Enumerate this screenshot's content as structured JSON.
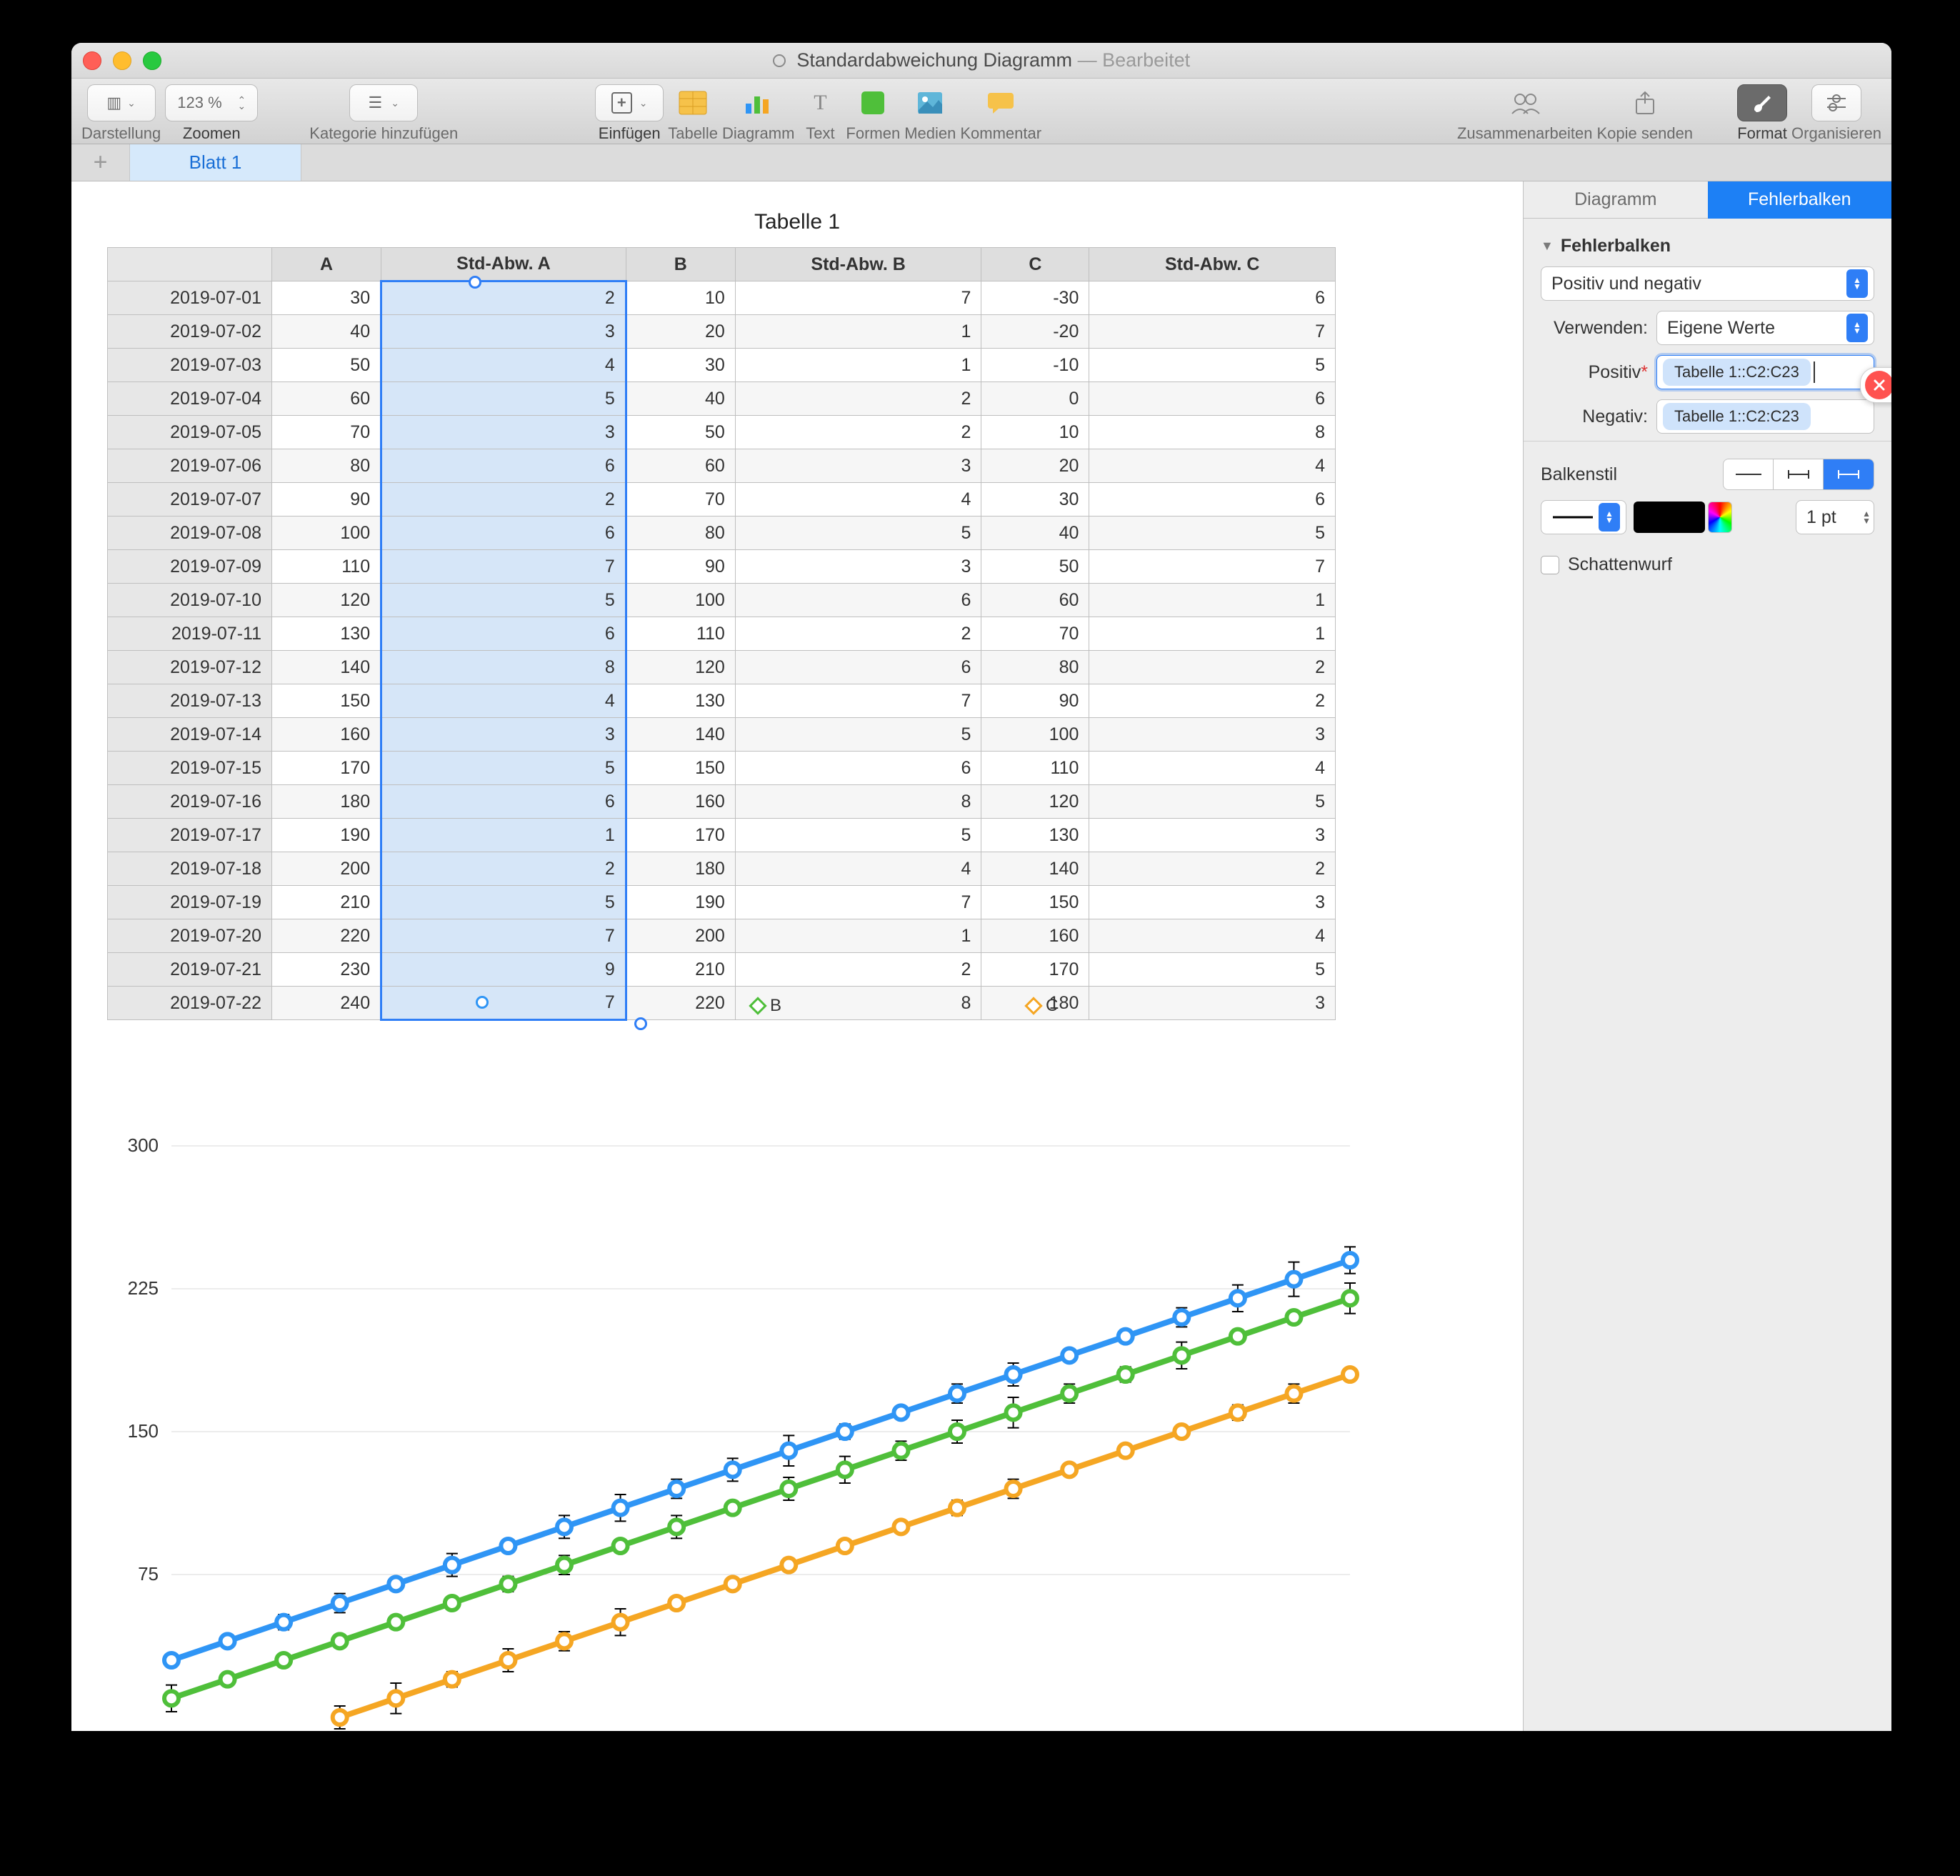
{
  "window": {
    "doc_title": "Standardabweichung Diagramm",
    "status": "Bearbeitet",
    "sep": " — "
  },
  "toolbar": {
    "view_label": "Darstellung",
    "zoom_value": "123 %",
    "zoom_label": "Zoomen",
    "category_label": "Kategorie hinzufügen",
    "insert_label": "Einfügen",
    "table_label": "Tabelle",
    "chart_label": "Diagramm",
    "text_label": "Text",
    "shapes_label": "Formen",
    "media_label": "Medien",
    "comment_label": "Kommentar",
    "collab_label": "Zusammenarbeiten",
    "share_label": "Kopie senden",
    "format_label": "Format",
    "organize_label": "Organisieren"
  },
  "sheets": {
    "add": "+",
    "tab1": "Blatt 1"
  },
  "inspector": {
    "tab_chart": "Diagramm",
    "tab_error": "Fehlerbalken",
    "section": "Fehlerbalken",
    "mode": "Positiv und negativ",
    "use_label": "Verwenden:",
    "use_value": "Eigene Werte",
    "pos_label": "Positiv",
    "neg_label": "Negativ:",
    "range_token": "Tabelle 1::C2:C23",
    "barstyle_label": "Balkenstil",
    "width_value": "1 pt",
    "shadow_label": "Schattenwurf"
  },
  "table": {
    "title": "Tabelle 1",
    "columns": [
      "",
      "A",
      "Std-Abw. A",
      "B",
      "Std-Abw. B",
      "C",
      "Std-Abw. C"
    ],
    "rows": [
      [
        "2019-07-01",
        30,
        2,
        10,
        7,
        -30,
        6
      ],
      [
        "2019-07-02",
        40,
        3,
        20,
        1,
        -20,
        7
      ],
      [
        "2019-07-03",
        50,
        4,
        30,
        1,
        -10,
        5
      ],
      [
        "2019-07-04",
        60,
        5,
        40,
        2,
        0,
        6
      ],
      [
        "2019-07-05",
        70,
        3,
        50,
        2,
        10,
        8
      ],
      [
        "2019-07-06",
        80,
        6,
        60,
        3,
        20,
        4
      ],
      [
        "2019-07-07",
        90,
        2,
        70,
        4,
        30,
        6
      ],
      [
        "2019-07-08",
        100,
        6,
        80,
        5,
        40,
        5
      ],
      [
        "2019-07-09",
        110,
        7,
        90,
        3,
        50,
        7
      ],
      [
        "2019-07-10",
        120,
        5,
        100,
        6,
        60,
        1
      ],
      [
        "2019-07-11",
        130,
        6,
        110,
        2,
        70,
        1
      ],
      [
        "2019-07-12",
        140,
        8,
        120,
        6,
        80,
        2
      ],
      [
        "2019-07-13",
        150,
        4,
        130,
        7,
        90,
        2
      ],
      [
        "2019-07-14",
        160,
        3,
        140,
        5,
        100,
        3
      ],
      [
        "2019-07-15",
        170,
        5,
        150,
        6,
        110,
        4
      ],
      [
        "2019-07-16",
        180,
        6,
        160,
        8,
        120,
        5
      ],
      [
        "2019-07-17",
        190,
        1,
        170,
        5,
        130,
        3
      ],
      [
        "2019-07-18",
        200,
        2,
        180,
        4,
        140,
        2
      ],
      [
        "2019-07-19",
        210,
        5,
        190,
        7,
        150,
        3
      ],
      [
        "2019-07-20",
        220,
        7,
        200,
        1,
        160,
        4
      ],
      [
        "2019-07-21",
        230,
        9,
        210,
        2,
        170,
        5
      ],
      [
        "2019-07-22",
        240,
        7,
        220,
        8,
        180,
        3
      ]
    ],
    "legend_b": "B",
    "legend_c": "C"
  },
  "chart_data": {
    "type": "line",
    "title": "",
    "xlabel": "",
    "ylabel": "",
    "ylim": [
      0,
      300
    ],
    "yticks": [
      75,
      150,
      225,
      300
    ],
    "categories": [
      "2019-07-01",
      "2019-07-02",
      "2019-07-03",
      "2019-07-04",
      "2019-07-05",
      "2019-07-06",
      "2019-07-07",
      "2019-07-08",
      "2019-07-09",
      "2019-07-10",
      "2019-07-11",
      "2019-07-12",
      "2019-07-13",
      "2019-07-14",
      "2019-07-15",
      "2019-07-16",
      "2019-07-17",
      "2019-07-18",
      "2019-07-19",
      "2019-07-20",
      "2019-07-21",
      "2019-07-22"
    ],
    "series": [
      {
        "name": "A",
        "color": "#2f95f5",
        "values": [
          30,
          40,
          50,
          60,
          70,
          80,
          90,
          100,
          110,
          120,
          130,
          140,
          150,
          160,
          170,
          180,
          190,
          200,
          210,
          220,
          230,
          240
        ],
        "err": [
          2,
          3,
          4,
          5,
          3,
          6,
          2,
          6,
          7,
          5,
          6,
          8,
          4,
          3,
          5,
          6,
          1,
          2,
          5,
          7,
          9,
          7
        ]
      },
      {
        "name": "B",
        "color": "#4fbf3a",
        "values": [
          10,
          20,
          30,
          40,
          50,
          60,
          70,
          80,
          90,
          100,
          110,
          120,
          130,
          140,
          150,
          160,
          170,
          180,
          190,
          200,
          210,
          220
        ],
        "err": [
          7,
          1,
          1,
          2,
          2,
          3,
          4,
          5,
          3,
          6,
          2,
          6,
          7,
          5,
          6,
          8,
          5,
          4,
          7,
          1,
          2,
          8
        ]
      },
      {
        "name": "C",
        "color": "#f5a623",
        "values": [
          -30,
          -20,
          -10,
          0,
          10,
          20,
          30,
          40,
          50,
          60,
          70,
          80,
          90,
          100,
          110,
          120,
          130,
          140,
          150,
          160,
          170,
          180
        ],
        "err": [
          6,
          7,
          5,
          6,
          8,
          4,
          6,
          5,
          7,
          1,
          1,
          2,
          2,
          3,
          4,
          5,
          3,
          2,
          3,
          4,
          5,
          3
        ]
      }
    ]
  }
}
